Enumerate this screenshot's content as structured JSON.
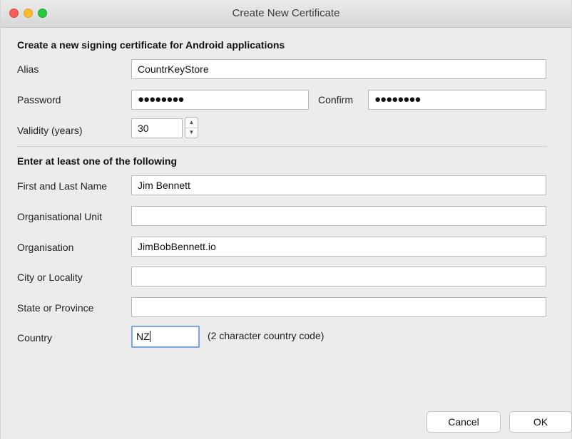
{
  "window": {
    "title": "Create New Certificate"
  },
  "sections": {
    "signing": "Create a new signing certificate for Android applications",
    "identity": "Enter at least one of the following"
  },
  "fields": {
    "alias": {
      "label": "Alias",
      "value": "CountrKeyStore"
    },
    "password": {
      "label": "Password",
      "value": "●●●●●●●●"
    },
    "confirm": {
      "label": "Confirm",
      "value": "●●●●●●●●"
    },
    "validity": {
      "label": "Validity (years)",
      "value": "30"
    },
    "first_last_name": {
      "label": "First and Last Name",
      "value": "Jim Bennett"
    },
    "org_unit": {
      "label": "Organisational Unit",
      "value": ""
    },
    "organisation": {
      "label": "Organisation",
      "value": "JimBobBennett.io"
    },
    "city": {
      "label": "City or Locality",
      "value": ""
    },
    "state": {
      "label": "State or Province",
      "value": ""
    },
    "country": {
      "label": "Country",
      "value": "NZ",
      "hint": "(2 character country code)"
    }
  },
  "buttons": {
    "cancel": "Cancel",
    "ok": "OK"
  },
  "stepper": {
    "up_icon": "▲",
    "down_icon": "▼"
  }
}
